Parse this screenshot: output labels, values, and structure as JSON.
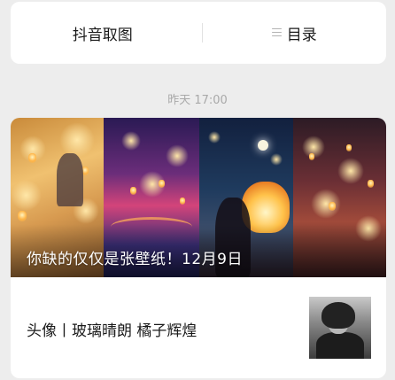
{
  "top_menu": {
    "left_label": "抖音取图",
    "right_label": "目录",
    "right_icon": "menu-icon"
  },
  "timestamp": "昨天 17:00",
  "article": {
    "cover_title": "你缺的仅仅是张壁纸！12月9日",
    "sub_title": "头像丨玻璃晴朗 橘子辉煌"
  }
}
